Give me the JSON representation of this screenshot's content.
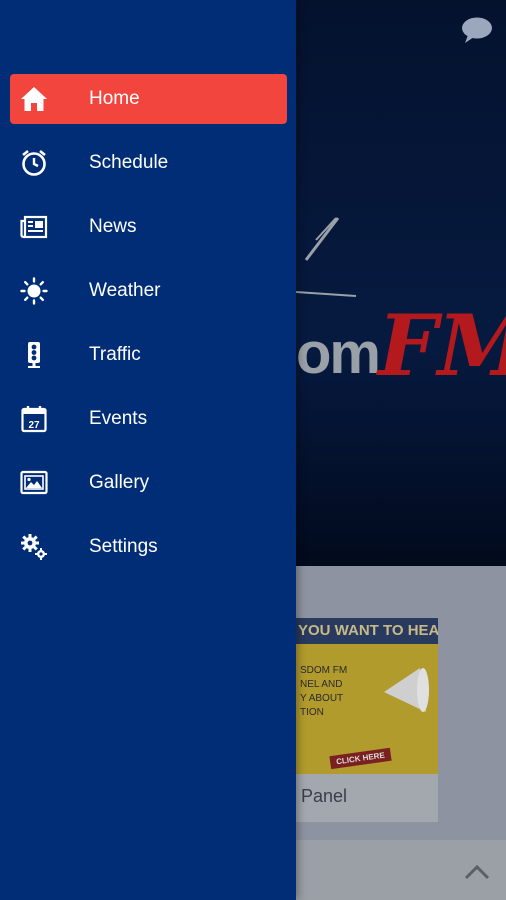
{
  "colors": {
    "drawer_bg": "#002d75",
    "active_item_bg": "#f1453d",
    "menu_text": "#ffffff",
    "logo_accent": "#b3191d"
  },
  "drawer": {
    "items": [
      {
        "label": "Home",
        "icon": "home-icon",
        "active": true
      },
      {
        "label": "Schedule",
        "icon": "alarm-clock-icon",
        "active": false
      },
      {
        "label": "News",
        "icon": "newspaper-icon",
        "active": false
      },
      {
        "label": "Weather",
        "icon": "sun-icon",
        "active": false
      },
      {
        "label": "Traffic",
        "icon": "traffic-light-icon",
        "active": false
      },
      {
        "label": "Events",
        "icon": "calendar-icon",
        "active": false
      },
      {
        "label": "Gallery",
        "icon": "image-gallery-icon",
        "active": false
      },
      {
        "label": "Settings",
        "icon": "gears-icon",
        "active": false
      }
    ],
    "calendar_day": "27"
  },
  "background": {
    "logo_partial": "om",
    "logo_fm": "FM",
    "promo": {
      "banner": "YOU WANT TO HEAR",
      "lines": [
        "SDOM FM",
        "NEL AND",
        "Y ABOUT",
        "TION"
      ],
      "button": "CLICK HERE",
      "caption": "er Panel"
    }
  }
}
